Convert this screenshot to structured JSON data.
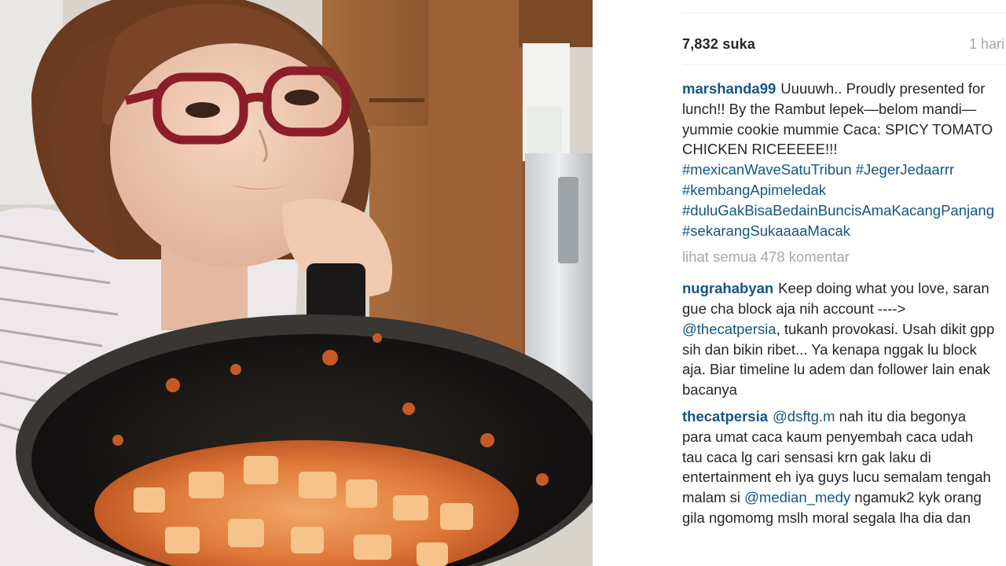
{
  "post": {
    "likes": "7,832 suka",
    "time": "1 hari",
    "caption": {
      "username": "marshanda99",
      "text": "Uuuuwh.. Proudly presented for lunch!! By the Rambut lepek—belom mandi—yummie cookie mummie Caca: SPICY TOMATO CHICKEN RICEEEEE!!!",
      "hashtags": [
        "#mexicanWaveSatuTribun",
        "#JegerJedaarrr",
        "#kembangApimeledak",
        "#duluGakBisaBedainBuncisAmaKacangPanjang",
        "#sekarangSukaaaaMacak"
      ]
    },
    "view_all_comments": "lihat semua 478 komentar",
    "comments": [
      {
        "username": "nugrahabyan",
        "text_before": "Keep doing what you love, saran gue cha block aja nih account ---->",
        "mention": "@thecatpersia",
        "text_after": ", tukanh provokasi. Usah dikit gpp sih dan bikin ribet... Ya kenapa nggak lu block aja. Biar timeline lu adem dan follower lain enak bacanya"
      },
      {
        "username": "thecatpersia",
        "mention": "@dsftg.m",
        "text_after": "nah itu dia begonya para umat caca kaum penyembah caca udah tau caca lg cari sensasi krn gak laku di entertainment eh iya guys lucu semalam tengah malam si",
        "mention2": "@median_medy",
        "text_end": "ngamuk2 kyk orang gila ngomomg mslh moral segala lha dia dan"
      }
    ]
  },
  "colors": {
    "link": "#125688",
    "text": "#262626",
    "muted": "#a5a7aa"
  }
}
